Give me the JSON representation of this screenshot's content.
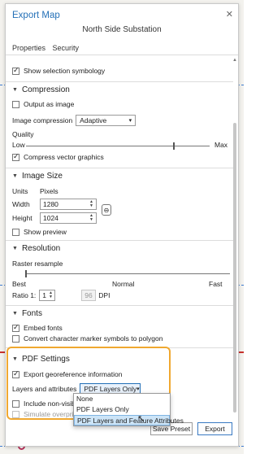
{
  "dialog": {
    "title": "Export Map",
    "close_glyph": "✕",
    "layer_name": "North Side Substation",
    "tabs": [
      "Properties",
      "Security"
    ]
  },
  "general": {
    "show_selection_symbology": "Show selection symbology"
  },
  "compression": {
    "header": "Compression",
    "output_as_image": "Output as image",
    "image_compression_label": "Image compression",
    "image_compression_value": "Adaptive",
    "quality_label": "Quality",
    "quality_low": "Low",
    "quality_max": "Max",
    "quality_fraction": 0.8,
    "compress_vector": "Compress vector graphics"
  },
  "image_size": {
    "header": "Image Size",
    "units_label": "Units",
    "units_value": "Pixels",
    "width_label": "Width",
    "width_value": "1280",
    "height_label": "Height",
    "height_value": "1024",
    "show_preview": "Show preview"
  },
  "resolution": {
    "header": "Resolution",
    "raster_resample": "Raster resample",
    "best": "Best",
    "normal": "Normal",
    "fast": "Fast",
    "resample_fraction": 0.0,
    "ratio_label": "Ratio 1:",
    "ratio_value": "1",
    "dpi_value": "96",
    "dpi_label": "DPI"
  },
  "fonts": {
    "header": "Fonts",
    "embed_fonts": "Embed fonts",
    "convert_markers": "Convert character marker symbols to polygon"
  },
  "pdf_settings": {
    "header": "PDF Settings",
    "export_georeference": "Export georeference information",
    "layers_attributes_label": "Layers and attributes",
    "layers_attributes_value": "PDF Layers Only",
    "include_non_visible": "Include non-visib",
    "simulate_overprint": "Simulate overprin",
    "options": [
      "None",
      "PDF Layers Only",
      "PDF Layers and Feature Attributes"
    ],
    "selected_option": "PDF Layers and Feature Attributes"
  },
  "buttons": {
    "save_preset": "Save Preset",
    "export": "Export"
  },
  "colors": {
    "accent": "#2470b7",
    "highlight": "#f0a830",
    "selection": "#cce4f7"
  }
}
